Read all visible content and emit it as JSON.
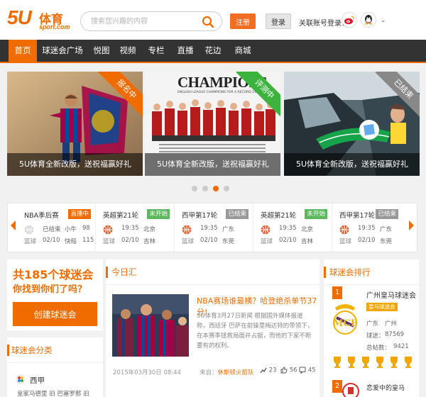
{
  "header": {
    "logo_main": "5U",
    "logo_cn": "体育",
    "logo_sub": "sport.com",
    "search_placeholder": "搜索您兴趣的内容",
    "register_label": "注册",
    "login_label": "登录",
    "associate_label": "关联账号登录：",
    "caret": "⌄"
  },
  "nav": {
    "items": [
      "首页",
      "球迷会广场",
      "悦图",
      "视频",
      "专栏",
      "直播",
      "花边",
      "商城"
    ],
    "active_index": 0
  },
  "banners": [
    {
      "caption": "5U体育全新改版，送祝福赢好礼",
      "ribbon": "报名中",
      "ribbon_color": "#f06c00"
    },
    {
      "caption": "5U体育全新改版，送祝福赢好礼",
      "ribbon": "评测中",
      "ribbon_color": "#3cb33c",
      "poster_title": "CHAMPIONS",
      "poster_sub": "ENGLISH LEAGUE CHAMPIONS FOR A RECORD 19TH TIME"
    },
    {
      "caption": "5U体育全新改版，送祝福赢好礼",
      "ribbon": "已结束",
      "ribbon_color": "#888888"
    }
  ],
  "carousel": {
    "count": 4,
    "active_index": 2
  },
  "matches": [
    {
      "title": "NBA季后赛",
      "status": "直播中",
      "status_color": "#f06c00",
      "kind": "篮球",
      "c1": [
        "已结束",
        "02/10"
      ],
      "c2": [
        "小牛",
        "快船"
      ],
      "c3": [
        "98",
        "115"
      ]
    },
    {
      "title": "英超第21轮",
      "status": "未开始",
      "status_color": "#5cb85c",
      "kind": "篮球",
      "c1": [
        "19:35",
        "02/10"
      ],
      "c2": [
        "北京",
        "吉林"
      ],
      "c3": [
        "",
        ""
      ]
    },
    {
      "title": "西甲第17轮",
      "status": "已结束",
      "status_color": "#999999",
      "kind": "篮球",
      "c1": [
        "19:35",
        "02/10"
      ],
      "c2": [
        "广东",
        "东莞"
      ],
      "c3": [
        "",
        ""
      ]
    },
    {
      "title": "英超第21轮",
      "status": "未开始",
      "status_color": "#5cb85c",
      "kind": "篮球",
      "c1": [
        "19:35",
        "02/10"
      ],
      "c2": [
        "北京",
        "吉林"
      ],
      "c3": [
        "",
        ""
      ]
    },
    {
      "title": "西甲第17轮",
      "status": "已结束",
      "status_color": "#999999",
      "kind": "篮球",
      "c1": [
        "19:35",
        "02/10"
      ],
      "c2": [
        "广东",
        "东莞"
      ],
      "c3": [
        "",
        ""
      ]
    }
  ],
  "promo": {
    "line1": "共185个球迷会",
    "line2": "你找到你们了吗？",
    "create_label": "创建球迷会"
  },
  "categories": {
    "heading": "球迷会分类",
    "league": "西甲",
    "clubs": "皇家马德里 旧 巴塞罗那 旧"
  },
  "today": {
    "heading": "今日汇",
    "news_title": "NBA赛场谁最横？哈登绝杀单节37分!",
    "news_body": "5U体育3月27日新闻 根据国外媒体报道称，西班牙 巴萨在前锋里梅达特的带领下，在本赛季拯救局面并占据，而他的下家不断要有的权利。",
    "date": "2015年03月30日  08:44",
    "source_prefix": "来自：",
    "source": "休斯顿火箭队",
    "likes": "23",
    "shares": "56",
    "comments": "45"
  },
  "rank": {
    "heading": "球迷会排行",
    "first": {
      "num": "1",
      "name": "广州皇马球迷会",
      "fan_badge": "皇马球迷会",
      "region_label": "广东",
      "region": "广州",
      "fans_label": "球迷：",
      "fans": "87569",
      "posts_label": "总帖数：",
      "posts": "9421"
    },
    "second": {
      "num": "2",
      "name": "恋爱中的皇马"
    }
  },
  "colors": {
    "accent": "#f06c00",
    "nav_bg": "#333333"
  }
}
